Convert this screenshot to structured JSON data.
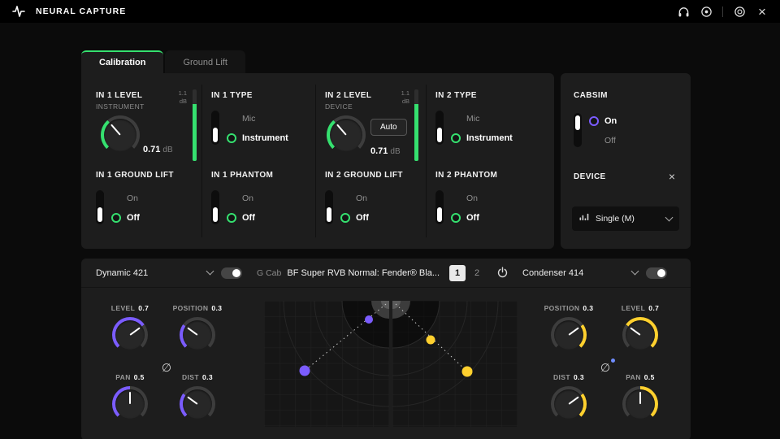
{
  "topbar": {
    "title": "NEURAL CAPTURE"
  },
  "icons": {
    "close": "×",
    "phase": "∅"
  },
  "tabs": {
    "calibration": "Calibration",
    "ground_lift": "Ground Lift"
  },
  "calibration": {
    "in1_level": {
      "title": "IN 1 LEVEL",
      "subtitle": "INSTRUMENT",
      "value": "0.71",
      "unit": "dB",
      "meter_db": "1.1",
      "meter_unit": "dB"
    },
    "in1_type": {
      "title": "IN 1 TYPE",
      "opt_mic": "Mic",
      "opt_instrument": "Instrument",
      "selected": "Instrument"
    },
    "in2_level": {
      "title": "IN 2 LEVEL",
      "subtitle": "DEVICE",
      "auto": "Auto",
      "value": "0.71",
      "unit": "dB",
      "meter_db": "1.1",
      "meter_unit": "dB"
    },
    "in2_type": {
      "title": "IN 2 TYPE",
      "opt_mic": "Mic",
      "opt_instrument": "Instrument",
      "selected": "Instrument"
    },
    "in1_ground": {
      "title": "IN 1 GROUND LIFT",
      "opt_on": "On",
      "opt_off": "Off",
      "selected": "Off"
    },
    "in1_phantom": {
      "title": "IN 1 PHANTOM",
      "opt_on": "On",
      "opt_off": "Off",
      "selected": "Off"
    },
    "in2_ground": {
      "title": "IN 2 GROUND LIFT",
      "opt_on": "On",
      "opt_off": "Off",
      "selected": "Off"
    },
    "in2_phantom": {
      "title": "IN 2 PHANTOM",
      "opt_on": "On",
      "opt_off": "Off",
      "selected": "Off"
    }
  },
  "cabsim": {
    "title": "CABSIM",
    "opt_on": "On",
    "opt_off": "Off",
    "selected": "On",
    "device_label": "DEVICE",
    "selector_value": "Single (M)"
  },
  "mixer": {
    "left_mic": "Dynamic 421",
    "cab_prefix": "G Cab",
    "cab_name": "BF Super RVB Normal: Fender® Bla...",
    "page1": "1",
    "page2": "2",
    "active_page": "1",
    "right_mic": "Condenser 414",
    "left": {
      "level_label": "LEVEL",
      "level_value": "0.7",
      "position_label": "POSITION",
      "position_value": "0.3",
      "pan_label": "PAN",
      "pan_value": "0.5",
      "dist_label": "DIST",
      "dist_value": "0.3"
    },
    "right": {
      "position_label": "POSITION",
      "position_value": "0.3",
      "level_label": "LEVEL",
      "level_value": "0.7",
      "dist_label": "DIST",
      "dist_value": "0.3",
      "pan_label": "PAN",
      "pan_value": "0.5"
    }
  },
  "colors": {
    "green": "#35e06f",
    "purple": "#7b5cff",
    "yellow": "#ffd02e"
  }
}
